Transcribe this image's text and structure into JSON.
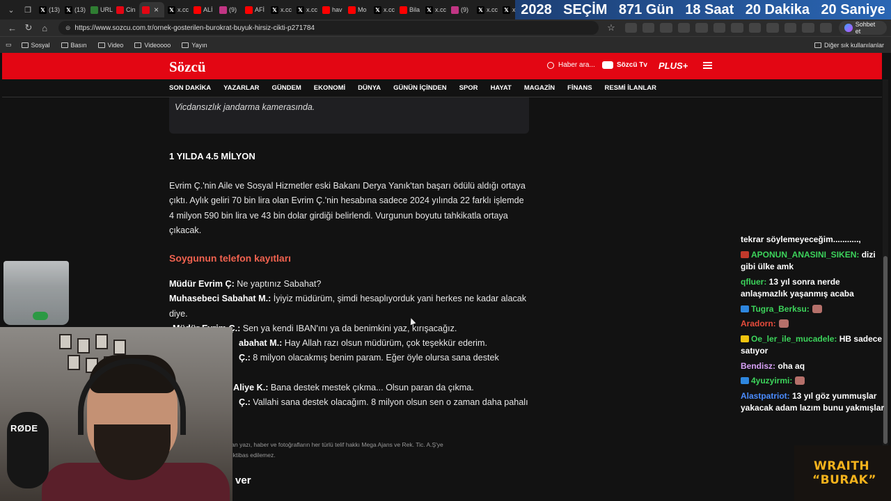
{
  "browser": {
    "tabs": [
      {
        "label": "(13)",
        "icon": "x-icon",
        "color": "#000000"
      },
      {
        "label": "(13)",
        "icon": "x-icon",
        "color": "#000000"
      },
      {
        "label": "URL",
        "icon": "chess-icon",
        "color": "#2f7d32"
      },
      {
        "label": "Cin",
        "icon": "sozcu-icon",
        "color": "#e30613"
      },
      {
        "label": "",
        "icon": "sozcu-icon",
        "color": "#e30613",
        "active": true
      },
      {
        "label": "x.cc",
        "icon": "x-icon",
        "color": "#000000"
      },
      {
        "label": "ALİ",
        "icon": "youtube-icon",
        "color": "#ff0000"
      },
      {
        "label": "(9)",
        "icon": "instagram-icon",
        "color": "#c13584"
      },
      {
        "label": "AFİ",
        "icon": "youtube-icon",
        "color": "#ff0000"
      },
      {
        "label": "x.cc",
        "icon": "x-icon",
        "color": "#000000"
      },
      {
        "label": "x.cc",
        "icon": "x-icon",
        "color": "#000000"
      },
      {
        "label": "hav",
        "icon": "youtube-icon",
        "color": "#ff0000"
      },
      {
        "label": "Mo",
        "icon": "youtube-icon",
        "color": "#ff0000"
      },
      {
        "label": "x.cc",
        "icon": "x-icon",
        "color": "#000000"
      },
      {
        "label": "Bila",
        "icon": "youtube-icon",
        "color": "#ff0000"
      },
      {
        "label": "x.cc",
        "icon": "x-icon",
        "color": "#000000"
      },
      {
        "label": "(9)",
        "icon": "instagram-icon",
        "color": "#c13584"
      },
      {
        "label": "x.cc",
        "icon": "x-icon",
        "color": "#000000"
      },
      {
        "label": "x.cc",
        "icon": "x-icon",
        "color": "#000000"
      }
    ],
    "url": "https://www.sozcu.com.tr/ornek-gosterilen-burokrat-buyuk-hirsiz-cikti-p271784",
    "chat_button": "Sohbet et",
    "bookmarks": [
      "Sosyal",
      "Basın",
      "Video",
      "Videoooo",
      "Yayın"
    ],
    "other_bookmarks": "Diğer sık kullanılanlar"
  },
  "countdown": {
    "year": "2028",
    "label": "SEÇİM",
    "days": "871 Gün",
    "hours": "18 Saat",
    "minutes": "20 Dakika",
    "seconds": "20 Saniye"
  },
  "site": {
    "logo": "Sözcü",
    "search_placeholder": "Haber ara...",
    "tv": "Sözcü Tv",
    "plus": "PLUS+",
    "nav": [
      "SON DAKİKA",
      "YAZARLAR",
      "GÜNDEM",
      "EKONOMİ",
      "DÜNYA",
      "GÜNÜN İÇİNDEN",
      "SPOR",
      "HAYAT",
      "MAGAZİN",
      "FİNANS",
      "RESMİ İLANLAR"
    ]
  },
  "article": {
    "caption": "Vicdansızlık  jandarma kamerasında.",
    "heading": "1 YILDA 4.5 MİLYON",
    "paragraph": "Evrim Ç.'nin Aile ve Sosyal Hizmetler eski Bakanı Derya Yanık'tan başarı ödülü aldığı ortaya çıktı. Aylık geliri 70 bin lira olan Evrim Ç.'nin hesabına sadece 2024 yılında 22 farklı işlemde 4 milyon 590 bin lira ve 43 bin dolar girdiği belirlendi. Vurgunun boyutu tahkikatla ortaya çıkacak.",
    "subheading": "Soygunun telefon kayıtları",
    "dialog": [
      {
        "speaker": "Müdür Evrim Ç:",
        "text": " Ne yaptınız Sabahat?"
      },
      {
        "speaker": "Muhasebeci Sabahat M.:",
        "text": " İyiyiz müdürüm, şimdi hesaplıyorduk yani herkes ne kadar alacak diye."
      },
      {
        "speaker": "Müdür Evrim Ç.:",
        "text": " Sen ya kendi IBAN'ını ya da benimkini yaz, kırışacağız."
      },
      {
        "speaker": "abahat M.:",
        "text": " Hay Allah razı olsun müdürüm, çok teşekkür ederim."
      },
      {
        "speaker": "Ç.:",
        "text": " 8 milyon olacakmış benim param. Eğer öyle olursa sana destek"
      },
      {
        "speaker": "Aliye K.:",
        "text": " Bana destek mestek çıkma... Olsun paran da çıkma."
      },
      {
        "speaker": "Ç.:",
        "text": " Vallahi sana destek olacağım. 8 milyon olsun sen o zaman daha pahalı"
      }
    ],
    "copyright_line1": "ernet sitesinde yayınlanan yazı, haber ve fotoğrafların her türlü telif hakkı Mega Ajans ve Rek. Tic. A.Ş'ye",
    "copyright_line2": "aynak gösterilerek dahi iktibas edilemez.",
    "emoji_title": "moji ile tepki ver"
  },
  "chat": {
    "messages": [
      {
        "user": "",
        "text": "tekrar söylemeyeceğim...........,",
        "color": "#ffffff"
      },
      {
        "user": "APONUN_ANASINI_SIKEN:",
        "text": " dizi gibi ülke amk",
        "color": "#3cd45b",
        "badge": "#c0392b"
      },
      {
        "user": "qfluer:",
        "text": " 13 yıl sonra nerde anlaşmazlık yaşanmış acaba",
        "color": "#3cd45b"
      },
      {
        "user": "Tugra_Berksu:",
        "text": "",
        "color": "#3cd45b",
        "badge": "#2e86de",
        "emote": true
      },
      {
        "user": "Aradorn:",
        "text": "",
        "color": "#e74c3c",
        "emote": true
      },
      {
        "user": "Oe_ler_ile_mucadele:",
        "text": " HB sadece satıyor",
        "color": "#3cd45b",
        "badge": "#f1c40f"
      },
      {
        "user": "Bendisz:",
        "text": " oha aq",
        "color": "#d7a1f5"
      },
      {
        "user": "4yuzyirmi:",
        "text": "",
        "color": "#3cd45b",
        "badge": "#2e86de",
        "emote": true
      },
      {
        "user": "Alastpatriot:",
        "text": " 13 yıl göz yummuşlar yakacak adam lazım bunu yakmışlar",
        "color": "#4a8cff"
      }
    ]
  },
  "overlay": {
    "mic_brand": "RØDE",
    "wraith_line1": "WRAITH",
    "wraith_line2": "“BURAK”"
  }
}
